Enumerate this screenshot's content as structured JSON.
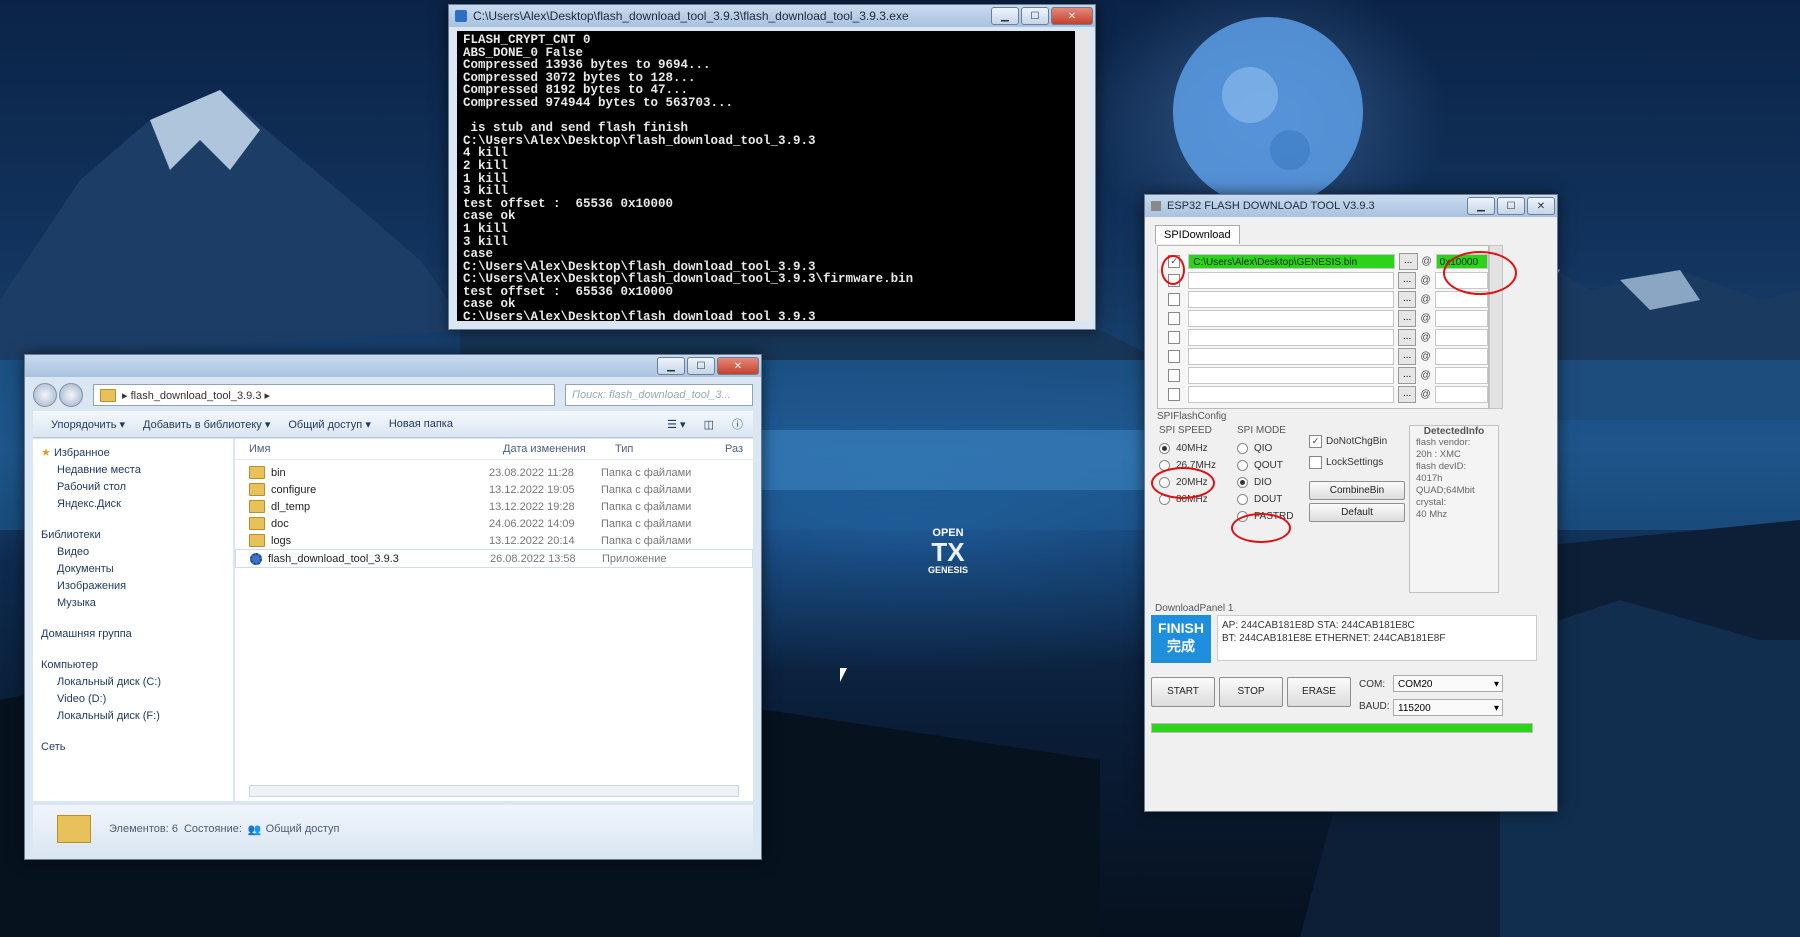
{
  "console": {
    "title": "C:\\Users\\Alex\\Desktop\\flash_download_tool_3.9.3\\flash_download_tool_3.9.3.exe",
    "lines": "FLASH_CRYPT_CNT 0\nABS_DONE_0 False\nCompressed 13936 bytes to 9694...\nCompressed 3072 bytes to 128...\nCompressed 8192 bytes to 47...\nCompressed 974944 bytes to 563703...\n\n is stub and send flash finish\nC:\\Users\\Alex\\Desktop\\flash_download_tool_3.9.3\n4 kill\n2 kill\n1 kill\n3 kill\ntest offset :  65536 0x10000\ncase ok\n1 kill\n3 kill\ncase\nC:\\Users\\Alex\\Desktop\\flash_download_tool_3.9.3\nC:\\Users\\Alex\\Desktop\\flash_download_tool_3.9.3\\firmware.bin\ntest offset :  65536 0x10000\ncase ok\nC:\\Users\\Alex\\Desktop\\flash_download_tool_3.9.3\nC:\\Users\\Alex\\Desktop\\GENESIS.bin"
  },
  "explorer": {
    "address": "▸ flash_download_tool_3.9.3 ▸",
    "search_placeholder": "Поиск: flash_download_tool_3...",
    "toolbar": {
      "organize": "Упорядочить ▾",
      "library": "Добавить в библиотеку ▾",
      "share": "Общий доступ ▾",
      "new_folder": "Новая папка"
    },
    "nav": {
      "favorites": "Избранное",
      "recent": "Недавние места",
      "desktop": "Рабочий стол",
      "yadisk": "Яндекс.Диск",
      "libraries": "Библиотеки",
      "video": "Видео",
      "documents": "Документы",
      "images": "Изображения",
      "music": "Музыка",
      "homegroup": "Домашняя группа",
      "computer": "Компьютер",
      "disk_c": "Локальный диск (C:)",
      "disk_d": "Video (D:)",
      "disk_f": "Локальный диск (F:)",
      "network": "Сеть"
    },
    "headers": {
      "name": "Имя",
      "date": "Дата изменения",
      "type": "Тип",
      "size": "Раз"
    },
    "files": [
      {
        "name": "bin",
        "date": "23.08.2022 11:28",
        "type": "Папка с файлами"
      },
      {
        "name": "configure",
        "date": "13.12.2022 19:05",
        "type": "Папка с файлами"
      },
      {
        "name": "dl_temp",
        "date": "13.12.2022 19:28",
        "type": "Папка с файлами"
      },
      {
        "name": "doc",
        "date": "24.06.2022 14:09",
        "type": "Папка с файлами"
      },
      {
        "name": "logs",
        "date": "13.12.2022 20:14",
        "type": "Папка с файлами"
      },
      {
        "name": "flash_download_tool_3.9.3",
        "date": "26.08.2022 13:58",
        "type": "Приложение"
      }
    ],
    "status": {
      "count": "Элементов: 6",
      "state_label": "Состояние:",
      "state": "Общий доступ"
    }
  },
  "desktop_icon": {
    "line1": "OPEN",
    "line2": "TX",
    "line3": "GENESIS"
  },
  "esp": {
    "title": "ESP32 FLASH DOWNLOAD TOOL V3.9.3",
    "tab": "SPIDownload",
    "file_rows": [
      {
        "checked": "✓",
        "path": "C:\\Users\\Alex\\Desktop\\GENESIS.bin",
        "address": "0x10000"
      },
      {
        "checked": "",
        "path": "",
        "address": ""
      },
      {
        "checked": "",
        "path": "",
        "address": ""
      },
      {
        "checked": "",
        "path": "",
        "address": ""
      },
      {
        "checked": "",
        "path": "",
        "address": ""
      },
      {
        "checked": "",
        "path": "",
        "address": ""
      },
      {
        "checked": "",
        "path": "",
        "address": ""
      },
      {
        "checked": "",
        "path": "",
        "address": ""
      }
    ],
    "browse": "...",
    "at": "@",
    "config_label": "SPIFlashConfig",
    "speed_label": "SPI SPEED",
    "speeds": [
      "40MHz",
      "26.7MHz",
      "20MHz",
      "80MHz"
    ],
    "speed_selected": "40MHz",
    "mode_label": "SPI MODE",
    "modes": [
      "QIO",
      "QOUT",
      "DIO",
      "DOUT",
      "FASTRD"
    ],
    "mode_selected": "DIO",
    "do_not_chg": "DoNotChgBin",
    "lock": "LockSettings",
    "combine": "CombineBin",
    "default": "Default",
    "detected_label": "DetectedInfo",
    "detected": "flash vendor:\n20h : XMC\nflash devID:\n4017h\nQUAD;64Mbit\ncrystal:\n40 Mhz",
    "panel_label": "DownloadPanel 1",
    "finish": "FINISH\n完成",
    "mac1": "AP:  244CAB181E8D  STA:  244CAB181E8C",
    "mac2": "BT:  244CAB181E8E  ETHERNET:  244CAB181E8F",
    "start": "START",
    "stop": "STOP",
    "erase": "ERASE",
    "com_label": "COM:",
    "com": "COM20",
    "baud_label": "BAUD:",
    "baud": "115200",
    "progress": 1.0
  }
}
